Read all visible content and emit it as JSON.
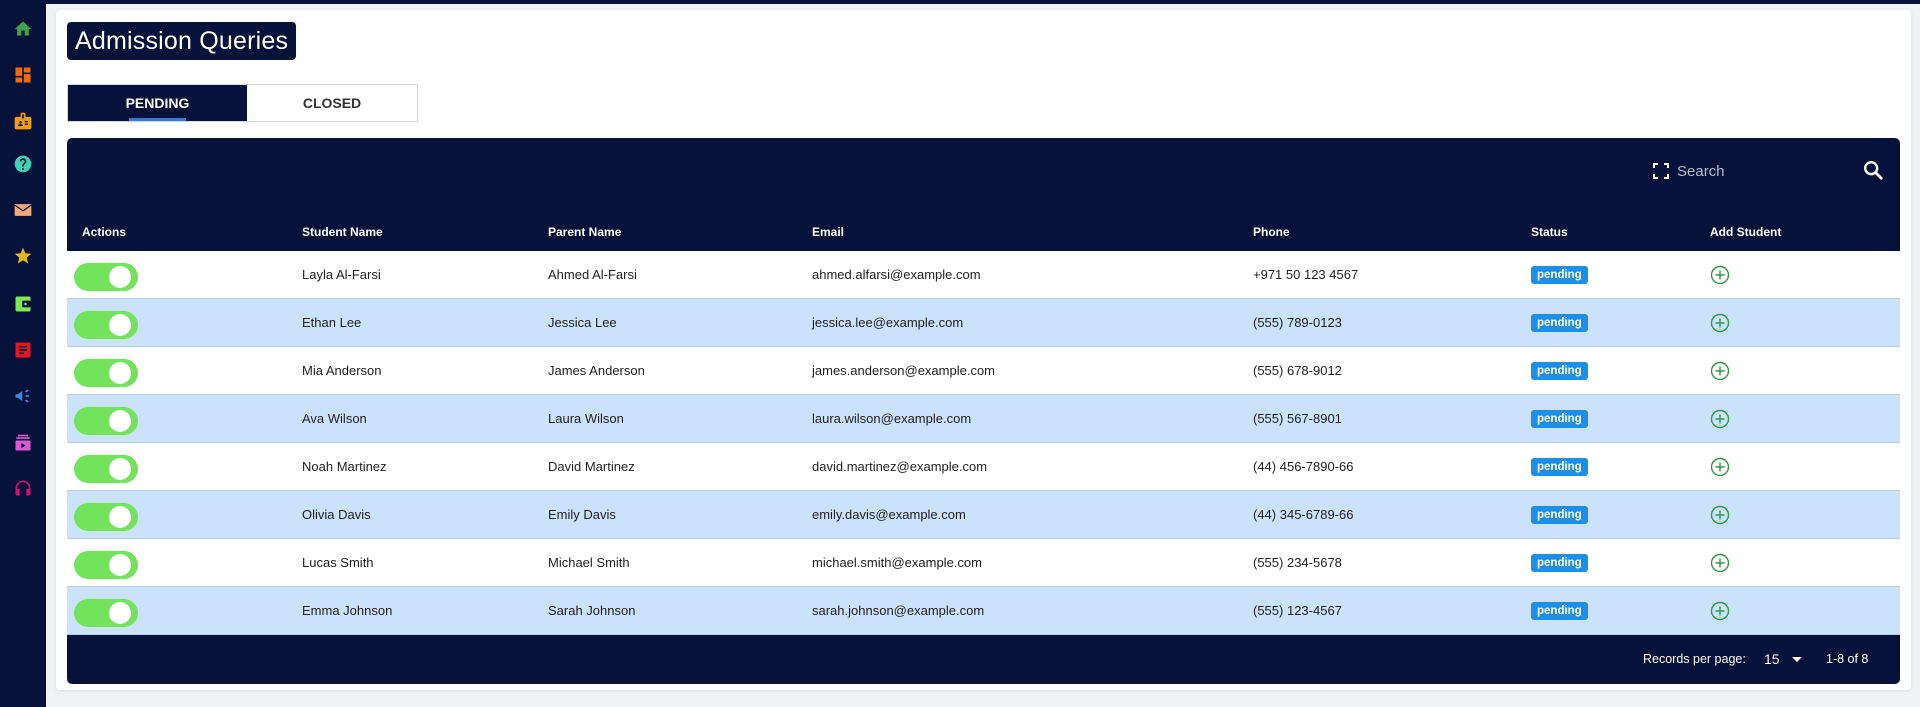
{
  "sidebar": {
    "items": [
      {
        "icon": "home-icon",
        "color": "#3ea24a"
      },
      {
        "icon": "dashboard-icon",
        "color": "#f26a10"
      },
      {
        "icon": "id-badge-icon",
        "color": "#f39a12"
      },
      {
        "icon": "help-icon",
        "color": "#3fd3b4"
      },
      {
        "icon": "mail-icon",
        "color": "#f5a77a"
      },
      {
        "icon": "star-icon",
        "color": "#e7b514"
      },
      {
        "icon": "wallet-icon",
        "color": "#7ee854"
      },
      {
        "icon": "document-icon",
        "color": "#e8141e"
      },
      {
        "icon": "megaphone-icon",
        "color": "#2e8ee8"
      },
      {
        "icon": "video-library-icon",
        "color": "#d65ad0"
      },
      {
        "icon": "headphones-icon",
        "color": "#d0106b"
      }
    ]
  },
  "header": {
    "title": "Admission Queries"
  },
  "tabs": [
    {
      "label": "PENDING",
      "active": true
    },
    {
      "label": "CLOSED",
      "active": false
    }
  ],
  "table": {
    "search": {
      "placeholder": "Search",
      "value": ""
    },
    "columns": [
      "Actions",
      "Student Name",
      "Parent Name",
      "Email",
      "Phone",
      "Status",
      "Add Student"
    ],
    "rows": [
      {
        "toggle": true,
        "student": "Layla Al-Farsi",
        "parent": "Ahmed Al-Farsi",
        "email": "ahmed.alfarsi@example.com",
        "phone": "+971 50 123 4567",
        "status": "pending"
      },
      {
        "toggle": true,
        "student": "Ethan Lee",
        "parent": "Jessica Lee",
        "email": "jessica.lee@example.com",
        "phone": "(555) 789-0123",
        "status": "pending"
      },
      {
        "toggle": true,
        "student": "Mia Anderson",
        "parent": "James Anderson",
        "email": "james.anderson@example.com",
        "phone": "(555) 678-9012",
        "status": "pending"
      },
      {
        "toggle": true,
        "student": "Ava Wilson",
        "parent": "Laura Wilson",
        "email": "laura.wilson@example.com",
        "phone": "(555) 567-8901",
        "status": "pending"
      },
      {
        "toggle": true,
        "student": "Noah Martinez",
        "parent": "David Martinez",
        "email": "david.martinez@example.com",
        "phone": "(44) 456-7890-66",
        "status": "pending"
      },
      {
        "toggle": true,
        "student": "Olivia Davis",
        "parent": "Emily Davis",
        "email": "emily.davis@example.com",
        "phone": "(44) 345-6789-66",
        "status": "pending"
      },
      {
        "toggle": true,
        "student": "Lucas Smith",
        "parent": "Michael Smith",
        "email": "michael.smith@example.com",
        "phone": "(555) 234-5678",
        "status": "pending"
      },
      {
        "toggle": true,
        "student": "Emma Johnson",
        "parent": "Sarah Johnson",
        "email": "sarah.johnson@example.com",
        "phone": "(555) 123-4567",
        "status": "pending"
      }
    ],
    "footer": {
      "records_per_page_label": "Records per page:",
      "records_per_page_value": "15",
      "range": "1-8 of 8"
    }
  },
  "colors": {
    "navy": "#06123a",
    "toggle_on": "#72e35a",
    "badge_pending": "#1e8fe6",
    "row_alt": "#cae3fb",
    "add_icon": "#2e9a3c",
    "tab_underline": "#2f7de1"
  }
}
